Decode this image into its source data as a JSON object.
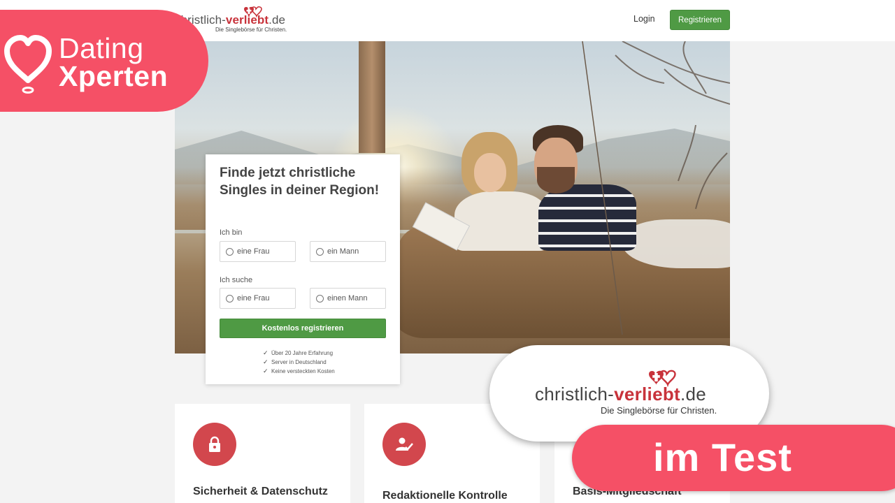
{
  "nav": {
    "logo_prefix": "christlich-",
    "logo_brand": "verliebt",
    "logo_suffix": ".de",
    "logo_tagline": "Die Singlebörse für Christen.",
    "login_label": "Login",
    "register_label": "Registrieren"
  },
  "registration": {
    "headline": "Finde jetzt christliche Singles in deiner Region!",
    "iam_label": "Ich bin",
    "iam_options": [
      "eine Frau",
      "ein Mann"
    ],
    "seeking_label": "Ich suche",
    "seeking_options": [
      "eine Frau",
      "einen Mann"
    ],
    "cta_label": "Kostenlos registrieren",
    "benefits": [
      "Über 20 Jahre Erfahrung",
      "Server in Deutschland",
      "Keine versteckten Kosten"
    ]
  },
  "features": [
    {
      "title": "Sicherheit & Datenschutz",
      "icon": "lock-icon"
    },
    {
      "title": "Redaktionelle Kontrolle",
      "icon": "user-check-icon"
    },
    {
      "title": "Basis-Mitgliedschaft",
      "icon": "member-icon"
    }
  ],
  "overlay": {
    "badge_line1": "Dating",
    "badge_line2": "Xperten",
    "logo_prefix": "christlich-",
    "logo_brand": "verliebt",
    "logo_suffix": ".de",
    "logo_tagline": "Die Singlebörse für Christen.",
    "test_label": "im Test"
  },
  "colors": {
    "accent_green": "#4f9a44",
    "brand_red": "#c8333b",
    "overlay_pink": "#f55066",
    "feature_icon_red": "#d2474d"
  }
}
